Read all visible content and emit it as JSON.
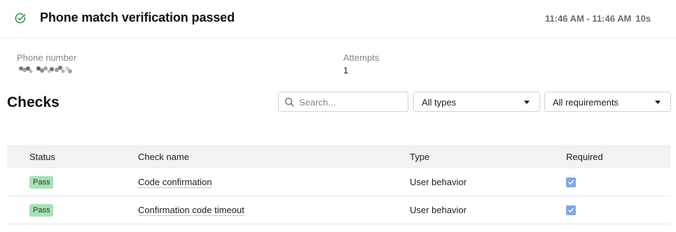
{
  "header": {
    "title": "Phone match verification passed",
    "time_range": "11:46 AM - 11:46 AM",
    "duration": "10s",
    "status_icon": "check-circle-icon",
    "status_color": "#2e9e4f"
  },
  "info": {
    "phone_label": "Phone number",
    "attempts_label": "Attempts",
    "attempts_value": "1"
  },
  "checks": {
    "title": "Checks",
    "search_placeholder": "Search...",
    "type_filter": "All types",
    "requirement_filter": "All requirements"
  },
  "table": {
    "columns": [
      "Status",
      "Check name",
      "Type",
      "Required"
    ],
    "rows": [
      {
        "status": "Pass",
        "name": "Code confirmation",
        "type": "User behavior",
        "required": true
      },
      {
        "status": "Pass",
        "name": "Confirmation code timeout",
        "type": "User behavior",
        "required": true
      }
    ]
  },
  "colors": {
    "pass_badge": "#a8e0b5",
    "checkbox": "#7ea8e8"
  }
}
